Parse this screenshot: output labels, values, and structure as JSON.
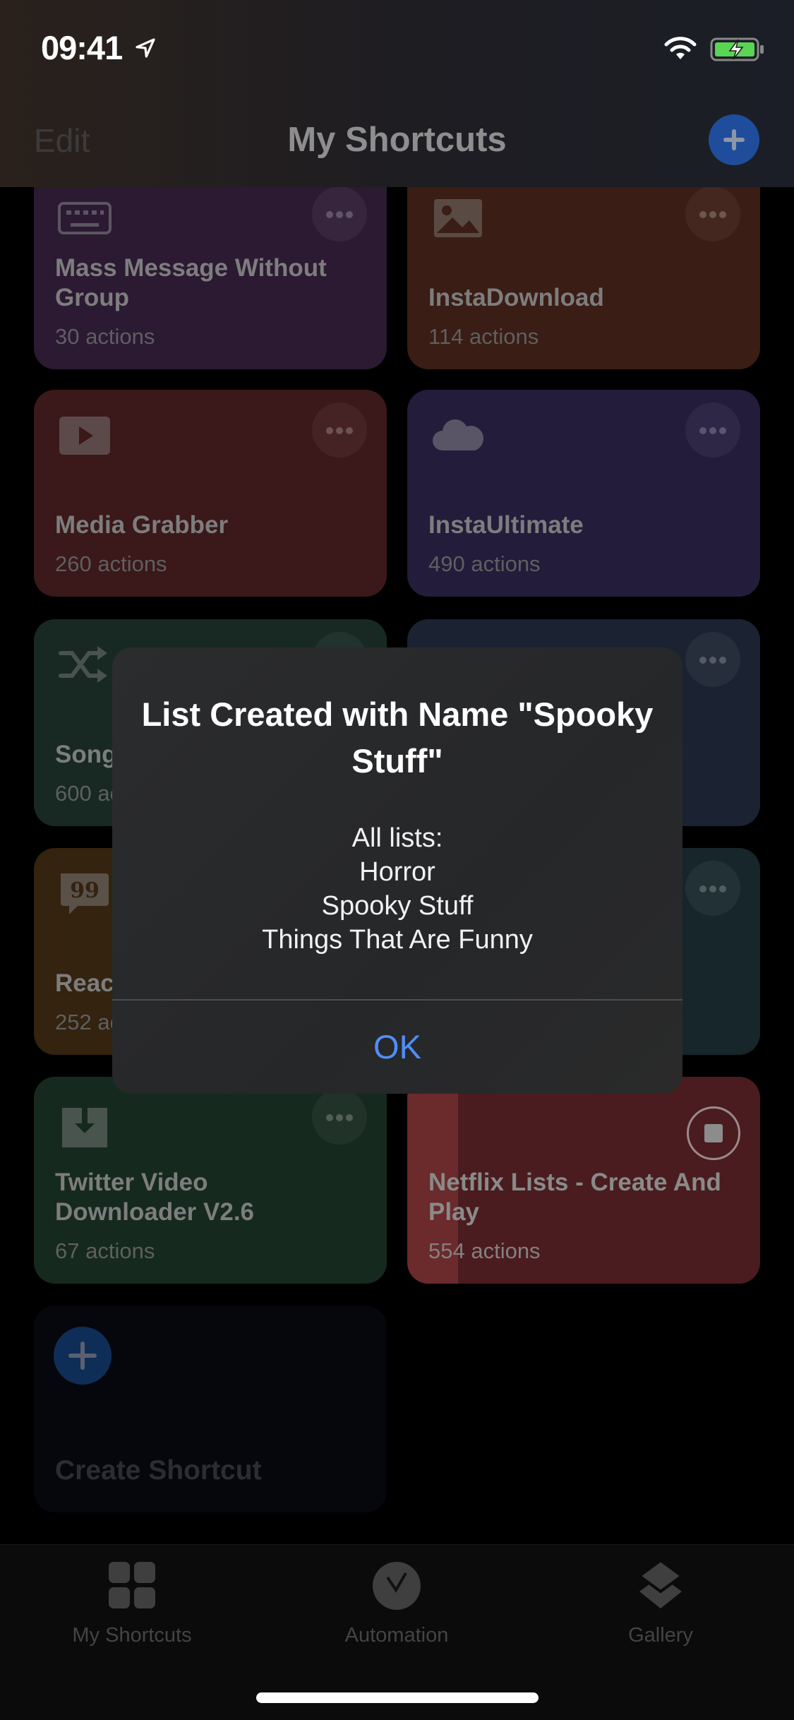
{
  "status_bar": {
    "time": "09:41",
    "icons": [
      "location-arrow-icon",
      "wifi-icon",
      "battery-charging-icon"
    ]
  },
  "nav": {
    "edit_label": "Edit",
    "title": "My Shortcuts",
    "add_icon": "plus-icon"
  },
  "shortcuts": [
    {
      "name": "Mass Message Without Group",
      "count": "30 actions",
      "icon": "keyboard-icon",
      "color": "#8e4fb0"
    },
    {
      "name": "InstaDownload",
      "count": "114 actions",
      "icon": "photo-icon",
      "color": "#c95a35"
    },
    {
      "name": "Media Grabber",
      "count": "260 actions",
      "icon": "play-icon",
      "color": "#c03d3d"
    },
    {
      "name": "InstaUltimate",
      "count": "490 actions",
      "icon": "cloud-icon",
      "color": "#6449b8"
    },
    {
      "name": "Song",
      "count": "600 actions",
      "icon": "shuffle-icon",
      "color": "#2f8a62"
    },
    {
      "name": "",
      "count": "",
      "icon": "unknown-icon",
      "color": "#3d5a8a"
    },
    {
      "name": "Reac",
      "count": "252 actions",
      "icon": "quote-bubble-icon",
      "color": "#b07a25"
    },
    {
      "name": "",
      "count": "",
      "icon": "unknown-icon",
      "color": "#2e6b78"
    },
    {
      "name": "Twitter Video Downloader V2.6",
      "count": "67 actions",
      "icon": "download-icon",
      "color": "#2b8a52"
    },
    {
      "name": "Netflix Lists - Create And Play",
      "count": "554 actions",
      "icon": "stop-icon",
      "color": "#d83b3f",
      "running": true
    }
  ],
  "create_card": {
    "label": "Create Shortcut"
  },
  "alert": {
    "title": "List Created with Name \"Spooky Stuff\"",
    "body_heading": "All lists:",
    "lists": [
      "Horror",
      "Spooky Stuff",
      "Things That Are Funny"
    ],
    "ok_label": "OK",
    "ok_color": "#4f8ef7"
  },
  "tabbar": {
    "tabs": [
      {
        "label": "My Shortcuts",
        "icon": "grid-icon"
      },
      {
        "label": "Automation",
        "icon": "clock-check-icon"
      },
      {
        "label": "Gallery",
        "icon": "layers-icon"
      }
    ]
  }
}
